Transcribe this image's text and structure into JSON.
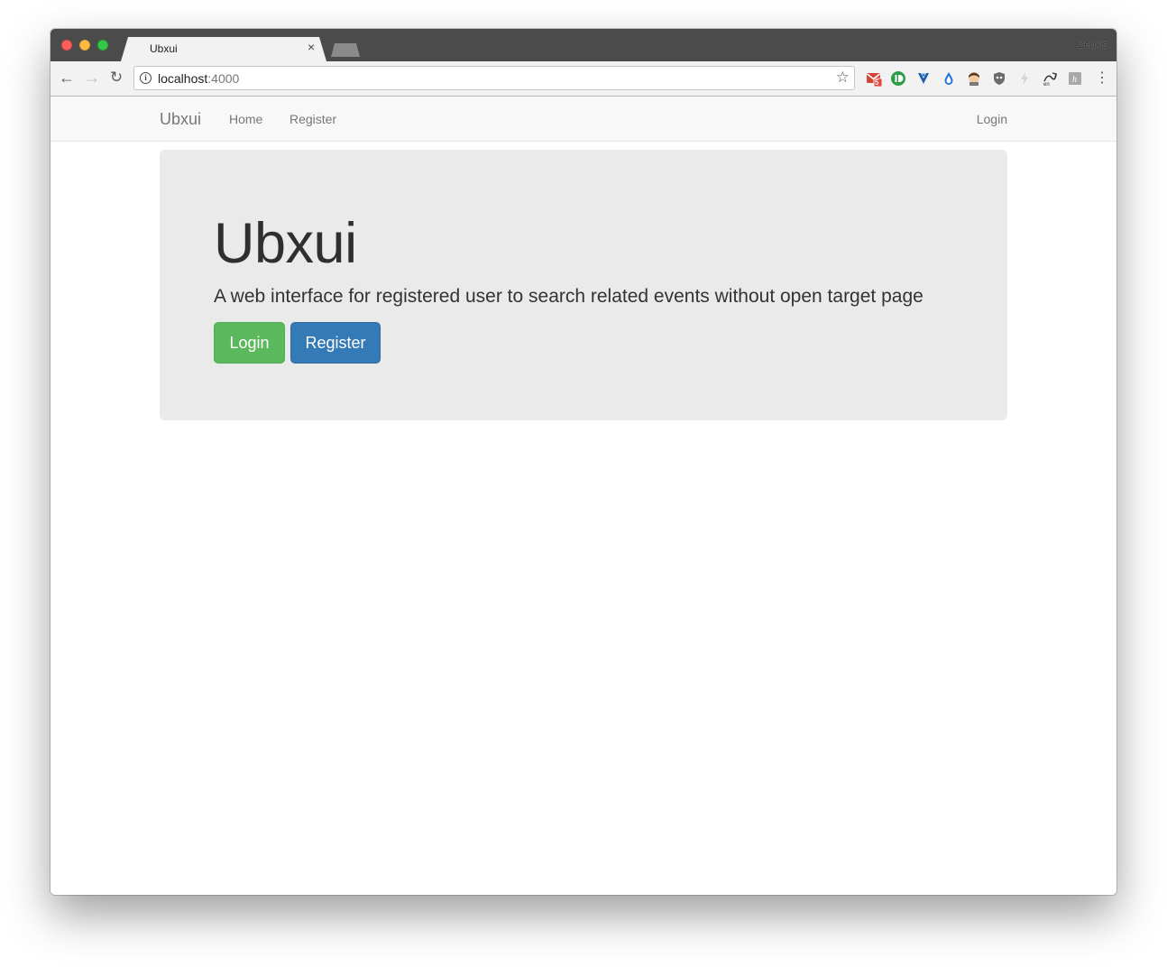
{
  "browser": {
    "tab_title": "Ubxui",
    "tab_close": "×",
    "profile_name": "Zeuxis",
    "url_host": "localhost",
    "url_port": ":4000",
    "gmail_badge": "5"
  },
  "navbar": {
    "brand": "Ubxui",
    "links": [
      "Home",
      "Register"
    ],
    "right_link": "Login"
  },
  "hero": {
    "title": "Ubxui",
    "lead": "A web interface for registered user to search related events without open target page",
    "login_button": "Login",
    "register_button": "Register"
  },
  "colors": {
    "success": "#5cb85c",
    "primary": "#337ab7",
    "jumbotron_bg": "#eaeaea"
  }
}
